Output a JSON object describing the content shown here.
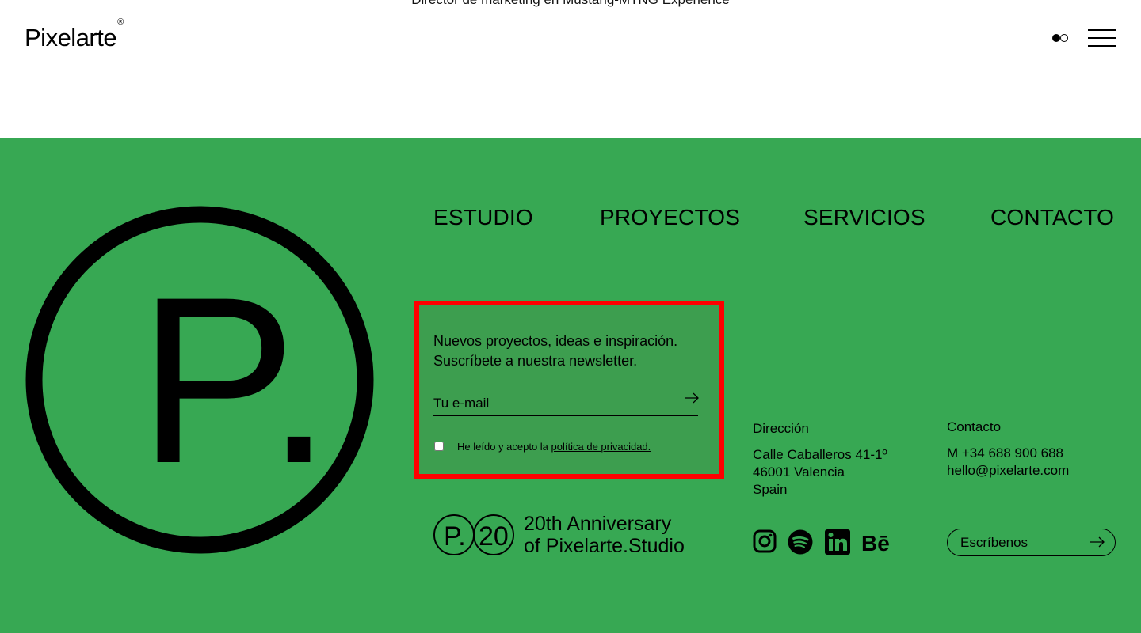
{
  "header": {
    "testimonial_cut": "Director de marketing en Mustang-MTNG Experience",
    "logo_text": "Pixelarte",
    "logo_mark": "®",
    "theme_toggle_icon": "theme-toggle-icon",
    "menu_icon": "hamburger-menu-icon"
  },
  "colors": {
    "footer_bg": "#37a853",
    "highlight_border": "#ff0000",
    "text": "#000000"
  },
  "footer": {
    "big_logo_letter": "P.",
    "nav": [
      "ESTUDIO",
      "PROYECTOS",
      "SERVICIOS",
      "CONTACTO"
    ],
    "newsletter": {
      "line1": "Nuevos proyectos, ideas e inspiración.",
      "line2": "Suscríbete a nuestra newsletter.",
      "email_placeholder": "Tu e-mail",
      "legal_prefix": "He leído y acepto la",
      "legal_link": "política de privacidad."
    },
    "anniversary": {
      "badge_p": "P.",
      "badge_20": "20",
      "line1": "20th Anniversary",
      "line2": "of Pixelarte.Studio"
    },
    "address": {
      "title": "Dirección",
      "line1": "Calle Caballeros 41-1º",
      "line2": "46001 Valencia",
      "line3": "Spain"
    },
    "contact": {
      "title": "Contacto",
      "phone": "M +34 688 900 688",
      "email": "hello@pixelarte.com"
    },
    "social": [
      "instagram-icon",
      "spotify-icon",
      "linkedin-icon",
      "behance-icon"
    ],
    "cta_label": "Escríbenos"
  }
}
